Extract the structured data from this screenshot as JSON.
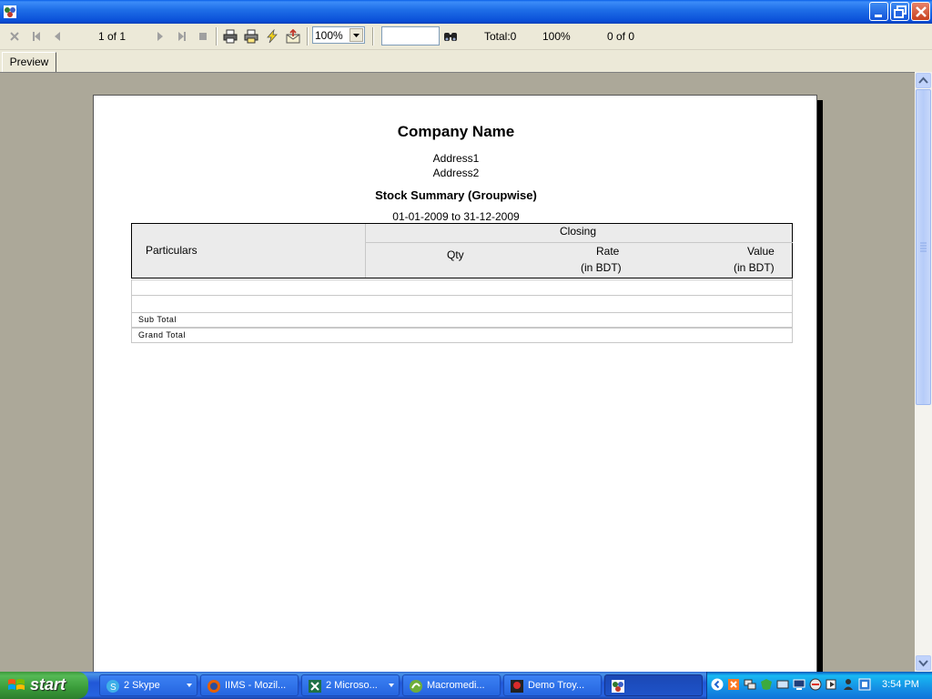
{
  "toolbar": {
    "page_indicator": "1 of 1",
    "zoom_value": "100%",
    "total_label": "Total:0",
    "percent_label": "100%",
    "match_count": "0 of 0"
  },
  "tabs": {
    "preview": "Preview"
  },
  "report": {
    "company": "Company Name",
    "address1": "Address1",
    "address2": "Address2",
    "title": "Stock Summary (Groupwise)",
    "period": "01-01-2009 to 31-12-2009",
    "headers": {
      "particulars": "Particulars",
      "closing": "Closing",
      "qty": "Qty",
      "rate": "Rate",
      "rate_unit": "(in BDT)",
      "value": "Value",
      "value_unit": "(in BDT)"
    },
    "sub_total": "Sub Total",
    "grand_total": "Grand Total"
  },
  "taskbar": {
    "start": "start",
    "tasks": [
      {
        "label": "2 Skype"
      },
      {
        "label": "IIMS - Mozil..."
      },
      {
        "label": "2 Microso..."
      },
      {
        "label": "Macromedi..."
      },
      {
        "label": "Demo Troy..."
      },
      {
        "label": ""
      }
    ],
    "clock": "3:54 PM"
  },
  "icons": {
    "titlebar": "app-icon",
    "toolbar": [
      "close-icon",
      "first-page-icon",
      "prev-page-icon",
      "next-page-icon",
      "last-page-icon",
      "stop-icon",
      "print-icon",
      "print-setup-icon",
      "refresh-icon",
      "export-icon",
      "find-icon"
    ]
  },
  "colors": {
    "titlebar": "#0A5FE8",
    "toolbar": "#ECE9D8",
    "workspace": "#ACA899",
    "taskbar": "#2457D7",
    "start": "#3C9A3C"
  }
}
